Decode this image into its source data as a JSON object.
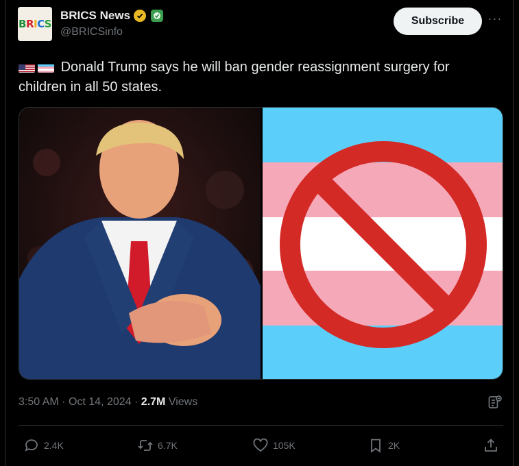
{
  "account": {
    "name": "BRICS News",
    "handle": "@BRICSinfo",
    "avatar_text": "BRICS"
  },
  "subscribe_label": "Subscribe",
  "more_glyph": "···",
  "tweet": {
    "text": "Donald Trump says he will ban gender reassignment surgery for children in all 50 states.",
    "flags": [
      "us-flag-icon",
      "trans-flag-icon"
    ]
  },
  "meta": {
    "time": "3:50 AM",
    "separator": "·",
    "date": "Oct 14, 2024",
    "views_count": "2.7M",
    "views_label": "Views"
  },
  "actions": {
    "reply": "2.4K",
    "repost": "6.7K",
    "like": "105K",
    "bookmark": "2K"
  },
  "colors": {
    "background": "#000000",
    "text_primary": "#e7e9ea",
    "text_secondary": "#71767b",
    "trans_blue": "#5bcefa",
    "trans_pink": "#f5a9b8",
    "prohibition_red": "#d42a26"
  }
}
